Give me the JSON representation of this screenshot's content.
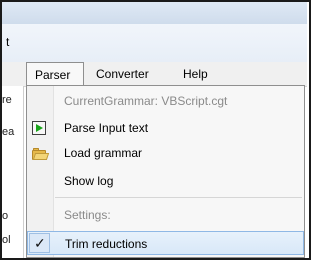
{
  "window": {
    "title_visible": "t"
  },
  "menubar": {
    "items": [
      {
        "label": "Parser"
      },
      {
        "label": "Converter"
      },
      {
        "label": "Help"
      }
    ]
  },
  "left_panel": {
    "chars": [
      "re",
      "ea",
      "o",
      "ol"
    ]
  },
  "parser_menu": {
    "current_grammar": "CurrentGrammar: VBScript.cgt",
    "items": [
      {
        "label": "Parse Input text",
        "icon": "play-icon"
      },
      {
        "label": "Load grammar",
        "icon": "folder-icon"
      },
      {
        "label": "Show log",
        "icon": ""
      }
    ],
    "settings_label": "Settings:",
    "trim_reductions": {
      "label": "Trim reductions",
      "checked": true
    }
  },
  "colors": {
    "accent_highlight": "#d8e8f8",
    "highlight_border": "#8fb8e5",
    "play_green": "#19a51a",
    "folder_yellow": "#e6b94a"
  }
}
